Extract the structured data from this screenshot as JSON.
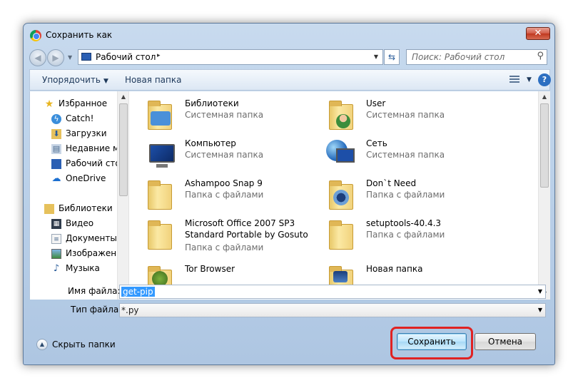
{
  "window": {
    "title": "Сохранить как",
    "close_label": "✕"
  },
  "address": {
    "location": "Рабочий стол",
    "separator": "▸"
  },
  "search": {
    "placeholder": "Поиск: Рабочий стол"
  },
  "toolbar": {
    "organize_label": "Упорядочить",
    "new_folder_label": "Новая папка",
    "help_label": "?"
  },
  "sidebar": {
    "items": [
      {
        "label": "Избранное",
        "icon": "star-icon"
      },
      {
        "label": "Catch!",
        "icon": "catch-icon"
      },
      {
        "label": "Загрузки",
        "icon": "downloads-icon"
      },
      {
        "label": "Недавние ме",
        "icon": "recent-places-icon"
      },
      {
        "label": "Рабочий стол",
        "icon": "desktop-icon"
      },
      {
        "label": "OneDrive",
        "icon": "onedrive-icon"
      },
      {
        "label": "Библиотеки",
        "icon": "libraries-icon"
      },
      {
        "label": "Видео",
        "icon": "video-icon"
      },
      {
        "label": "Документы",
        "icon": "documents-icon"
      },
      {
        "label": "Изображени",
        "icon": "pictures-icon"
      },
      {
        "label": "Музыка",
        "icon": "music-icon"
      }
    ]
  },
  "files": {
    "items": [
      {
        "name": "Библиотеки",
        "type": "Системная папка",
        "icon": "libraries-folder-icon"
      },
      {
        "name": "User",
        "type": "Системная папка",
        "icon": "user-folder-icon"
      },
      {
        "name": "Компьютер",
        "type": "Системная папка",
        "icon": "computer-icon"
      },
      {
        "name": "Сеть",
        "type": "Системная папка",
        "icon": "network-icon"
      },
      {
        "name": "Ashampoo Snap 9",
        "type": "Папка с файлами",
        "icon": "folder-icon"
      },
      {
        "name": "Don`t Need",
        "type": "Папка с файлами",
        "icon": "folder-icon"
      },
      {
        "name": "Microsoft Office 2007 SP3 Standard Portable by Gosuto",
        "type": "Папка с файлами",
        "icon": "folder-icon"
      },
      {
        "name": "setuptools-40.4.3",
        "type": "Папка с файлами",
        "icon": "folder-icon"
      },
      {
        "name": "Tor Browser",
        "type": "",
        "icon": "folder-icon"
      },
      {
        "name": "Новая папка",
        "type": "",
        "icon": "folder-icon"
      }
    ]
  },
  "filename": {
    "label": "Имя файла:",
    "value": "get-pip"
  },
  "filetype": {
    "label": "Тип файла:",
    "value": "*.py"
  },
  "footer": {
    "hide_folders_label": "Скрыть папки",
    "save_label": "Сохранить",
    "cancel_label": "Отмена"
  },
  "colors": {
    "highlight": "#e02222",
    "accent": "#3399ff"
  }
}
